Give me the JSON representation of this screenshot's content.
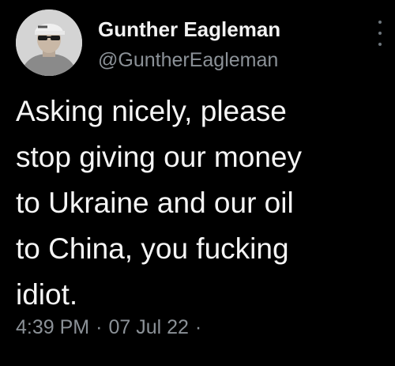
{
  "author": {
    "display_name": "Gunther Eagleman",
    "handle": "@GuntherEagleman",
    "avatar_icon": "profile-photo"
  },
  "tweet": {
    "lines": [
      "Asking nicely, please",
      "stop giving our money",
      "to Ukraine and our oil",
      "to China, you fucking",
      "idiot."
    ]
  },
  "meta": {
    "time": "4:39 PM",
    "separator": "·",
    "date": "07 Jul 22",
    "trailing_separator": "·"
  },
  "colors": {
    "background": "#000000",
    "text": "#f5f5f5",
    "secondary": "#8b9197"
  }
}
